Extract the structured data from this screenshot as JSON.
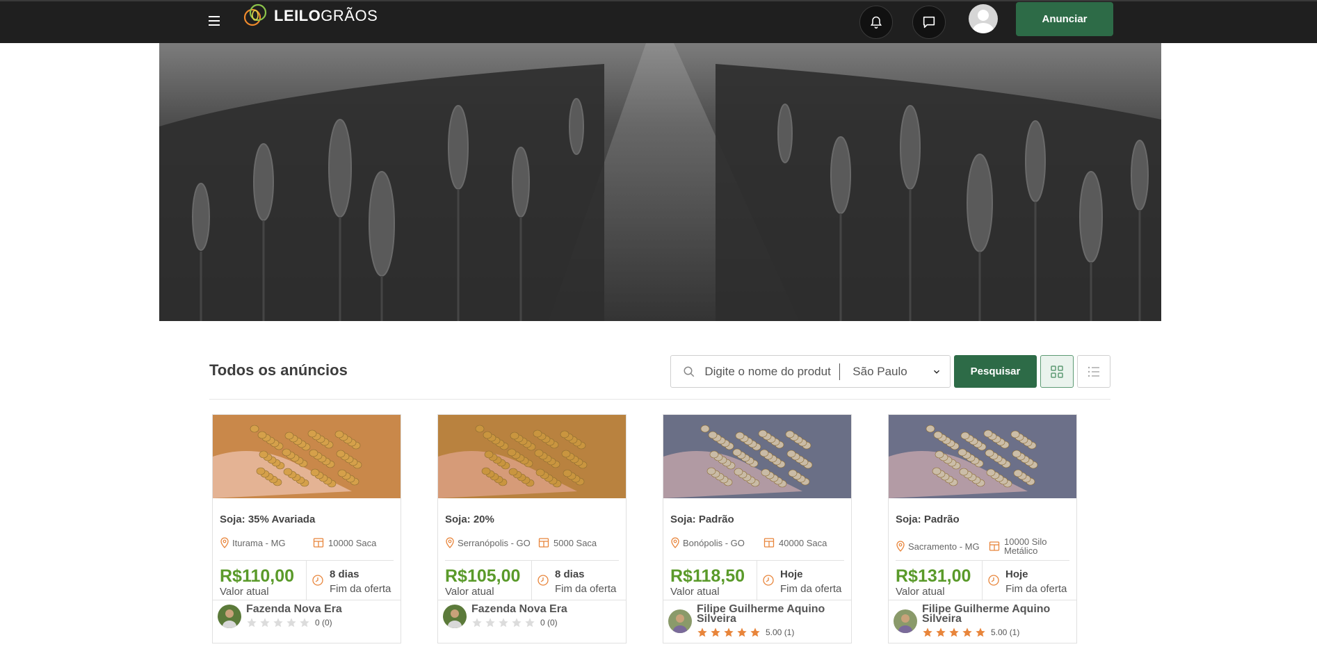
{
  "header": {
    "brand_bold": "LEILO",
    "brand_light": "GRÃOS",
    "announce_label": "Anunciar",
    "icons": [
      "menu-icon",
      "bell-icon",
      "chat-icon",
      "user-avatar-icon"
    ]
  },
  "main": {
    "title": "Todos os anúncios",
    "search": {
      "placeholder": "Digite o nome do produt",
      "state_value": "São Paulo",
      "button_label": "Pesquisar"
    },
    "view_modes": [
      "grid",
      "list"
    ]
  },
  "cards": [
    {
      "title": "Soja: 35% Avariada",
      "location": "Iturama - MG",
      "quantity": "10000 Saca",
      "price": "R$110,00",
      "price_label": "Valor atual",
      "time": "8 dias",
      "time_label": "Fim da oferta",
      "seller": "Fazenda Nova Era",
      "stars": 0,
      "rating": "0 (0)"
    },
    {
      "title": "Soja: 20%",
      "location": "Serranópolis - GO",
      "quantity": "5000 Saca",
      "price": "R$105,00",
      "price_label": "Valor atual",
      "time": "8 dias",
      "time_label": "Fim da oferta",
      "seller": "Fazenda Nova Era",
      "stars": 0,
      "rating": "0 (0)"
    },
    {
      "title": "Soja: Padrão",
      "location": "Bonópolis - GO",
      "quantity": "40000 Saca",
      "price": "R$118,50",
      "price_label": "Valor atual",
      "time": "Hoje",
      "time_label": "Fim da oferta",
      "seller": "Filipe Guilherme Aquino Silveira",
      "stars": 5,
      "rating": "5.00 (1)"
    },
    {
      "title": "Soja: Padrão",
      "location": "Sacramento - MG",
      "quantity": "10000 Silo Metálico",
      "price": "R$131,00",
      "price_label": "Valor atual",
      "time": "Hoje",
      "time_label": "Fim da oferta",
      "seller": "Filipe Guilherme Aquino Silveira",
      "stars": 5,
      "rating": "5.00 (1)"
    }
  ],
  "colors": {
    "primary": "#2d6b47",
    "price": "#5a9a2a",
    "accent_orange": "#e8853b",
    "header_bg": "#1f1f1f"
  }
}
